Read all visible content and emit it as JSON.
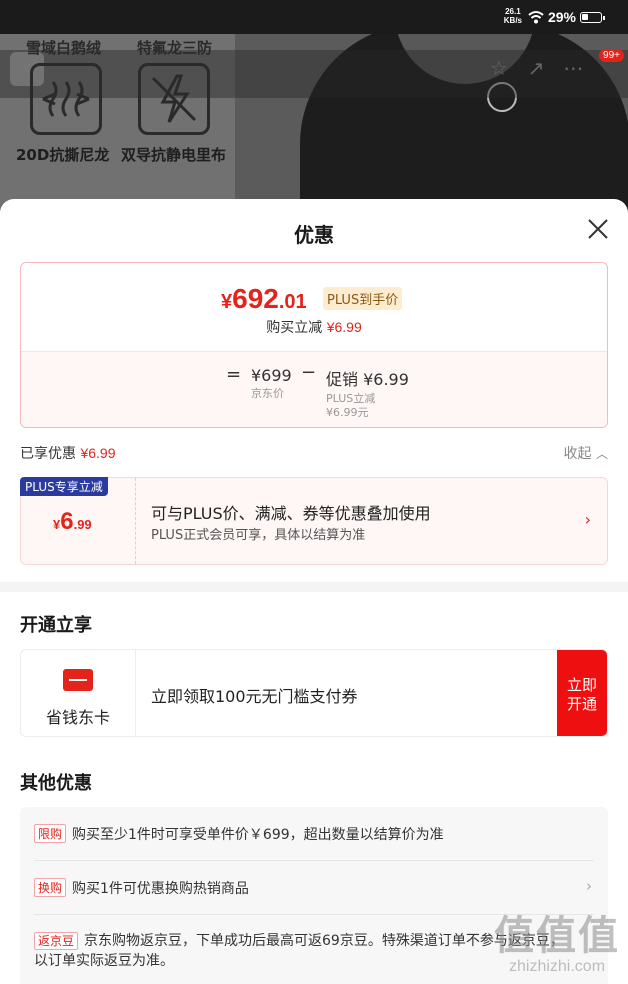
{
  "status_bar": {
    "net_speed": "26.1",
    "net_unit": "KB/s",
    "battery": "29%"
  },
  "product_photo": {
    "features": [
      {
        "label": "雪域白鹅绒",
        "caption": "20D抗撕尼龙"
      },
      {
        "label": "特氟龙三防",
        "caption": "双导抗静电里布"
      }
    ],
    "cart_badge": "99+"
  },
  "sheet": {
    "title": "优惠",
    "price_card": {
      "currency": "¥",
      "price_int": "692",
      "price_dec": ".01",
      "plus_tag": "PLUS到手价",
      "buy_save_label": "购买立减",
      "buy_save_value": "¥6.99",
      "equals": "=",
      "jd_price": "¥699",
      "jd_price_label": "京东价",
      "minus": "−",
      "promo": "促销 ¥6.99",
      "promo_sub1": "PLUS立减",
      "promo_sub2": "¥6.99元"
    },
    "enjoyed_label": "已享优惠",
    "enjoyed_value": "¥6.99",
    "collapse_label": "收起",
    "plus_card": {
      "flag": "PLUS专享立减",
      "currency": "¥",
      "amount_int": "6",
      "amount_dec": ".99",
      "line1": "可与PLUS价、满减、券等优惠叠加使用",
      "line2": "PLUS正式会员可享，具体以结算为准"
    },
    "open_section": {
      "title": "开通立享",
      "card_name": "省钱东卡",
      "desc": "立即领取100元无门槛支付券",
      "button_line1": "立即",
      "button_line2": "开通"
    },
    "other_section": {
      "title": "其他优惠",
      "rows": [
        {
          "tag": "限购",
          "text": "购买至少1件时可享受单件价￥699，超出数量以结算价为准"
        },
        {
          "tag": "换购",
          "text": "购买1件可优惠换购热销商品"
        },
        {
          "tag": "返京豆",
          "text": "京东购物返京豆，下单成功后最高可返69京豆。特殊渠道订单不参与返京豆，以订单实际返豆为准。"
        }
      ]
    }
  },
  "watermark": {
    "big": "值值值",
    "small": "zhizhizhi.com"
  }
}
